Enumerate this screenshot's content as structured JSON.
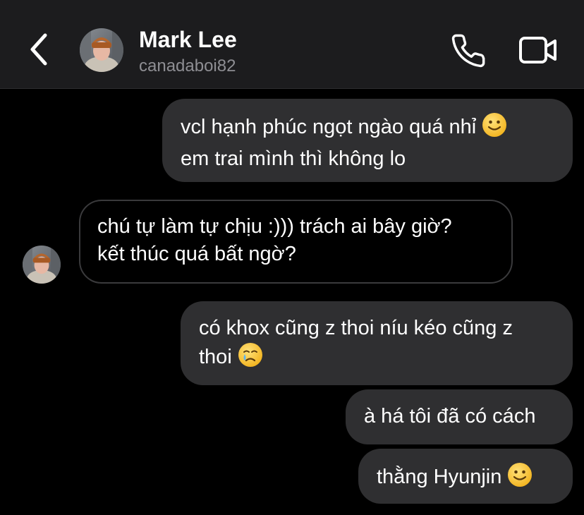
{
  "header": {
    "contact_name": "Mark Lee",
    "contact_handle": "canadaboi82",
    "icons": {
      "back": "chevron-left-icon",
      "avatar": "profile-photo",
      "call": "phone-icon",
      "video": "video-camera-icon"
    }
  },
  "messages": [
    {
      "direction": "outgoing",
      "lines": [
        "vcl hạnh phúc ngọt ngào quá nhỉ",
        "em trai mình thì không lo"
      ],
      "emoji": "slightly-smiling-face"
    },
    {
      "direction": "incoming",
      "lines": [
        "chú tự làm tự chịu :))) trách ai bây giờ?",
        "kết thúc quá bất ngờ?"
      ],
      "emoji": ""
    },
    {
      "direction": "outgoing",
      "lines": [
        "có khox cũng z thoi níu kéo cũng z",
        "thoi"
      ],
      "emoji": "crying-face"
    },
    {
      "direction": "outgoing",
      "lines": [
        "à há tôi đã có cách"
      ],
      "emoji": ""
    },
    {
      "direction": "outgoing",
      "lines": [
        "thằng Hyunjin"
      ],
      "emoji": "slightly-smiling-face"
    }
  ],
  "colors": {
    "header_bg": "#1c1c1e",
    "outgoing_bubble": "#2f2f31",
    "incoming_border": "#3a3a3c",
    "secondary_text": "#8e8e93",
    "emoji_yellow": "#f7c23b"
  }
}
